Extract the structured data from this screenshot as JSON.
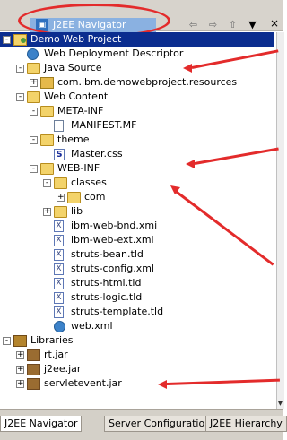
{
  "titlebar": {
    "title": "J2EE Navigator",
    "icon": "navigator-icon",
    "buttons": [
      "back-icon",
      "forward-icon",
      "up-icon",
      "menu-icon"
    ],
    "close": "×"
  },
  "tree": [
    {
      "text": "Demo Web Project",
      "icon": "project-icon",
      "depth": 0,
      "expander": "-",
      "selected": true
    },
    {
      "text": "Web Deployment Descriptor",
      "icon": "deployment-icon",
      "depth": 1,
      "expander": ""
    },
    {
      "text": "Java Source",
      "icon": "source-folder-icon",
      "depth": 1,
      "expander": "-"
    },
    {
      "text": "com.ibm.demowebproject.resources",
      "icon": "package-icon",
      "depth": 2,
      "expander": "+"
    },
    {
      "text": "Web Content",
      "icon": "web-folder-icon",
      "depth": 1,
      "expander": "-"
    },
    {
      "text": "META-INF",
      "icon": "folder-icon",
      "depth": 2,
      "expander": "-"
    },
    {
      "text": "MANIFEST.MF",
      "icon": "file-icon",
      "depth": 3,
      "expander": ""
    },
    {
      "text": "theme",
      "icon": "folder-icon",
      "depth": 2,
      "expander": "-"
    },
    {
      "text": "Master.css",
      "icon": "css-file-icon",
      "depth": 3,
      "expander": ""
    },
    {
      "text": "WEB-INF",
      "icon": "folder-icon",
      "depth": 2,
      "expander": "-"
    },
    {
      "text": "classes",
      "icon": "folder-icon",
      "depth": 3,
      "expander": "-"
    },
    {
      "text": "com",
      "icon": "folder-icon",
      "depth": 4,
      "expander": "+"
    },
    {
      "text": "lib",
      "icon": "folder-icon",
      "depth": 3,
      "expander": "+"
    },
    {
      "text": "ibm-web-bnd.xmi",
      "icon": "xmi-file-icon",
      "depth": 3,
      "expander": ""
    },
    {
      "text": "ibm-web-ext.xmi",
      "icon": "xmi-file-icon",
      "depth": 3,
      "expander": ""
    },
    {
      "text": "struts-bean.tld",
      "icon": "tld-file-icon",
      "depth": 3,
      "expander": ""
    },
    {
      "text": "struts-config.xml",
      "icon": "xml-file-icon",
      "depth": 3,
      "expander": ""
    },
    {
      "text": "struts-html.tld",
      "icon": "tld-file-icon",
      "depth": 3,
      "expander": ""
    },
    {
      "text": "struts-logic.tld",
      "icon": "tld-file-icon",
      "depth": 3,
      "expander": ""
    },
    {
      "text": "struts-template.tld",
      "icon": "tld-file-icon",
      "depth": 3,
      "expander": ""
    },
    {
      "text": "web.xml",
      "icon": "web-xml-icon",
      "depth": 3,
      "expander": ""
    },
    {
      "text": "Libraries",
      "icon": "libraries-icon",
      "depth": 0,
      "expander": "-"
    },
    {
      "text": "rt.jar",
      "icon": "jar-icon",
      "depth": 1,
      "expander": "+"
    },
    {
      "text": "j2ee.jar",
      "icon": "jar-icon",
      "depth": 1,
      "expander": "+"
    },
    {
      "text": "servletevent.jar",
      "icon": "jar-icon",
      "depth": 1,
      "expander": "+"
    }
  ],
  "tabs": [
    "J2EE Navigator",
    "Server Configuration",
    "J2EE Hierarchy"
  ],
  "colors": {
    "annotation": "#e32b2b",
    "selection": "#0b2d8f"
  }
}
